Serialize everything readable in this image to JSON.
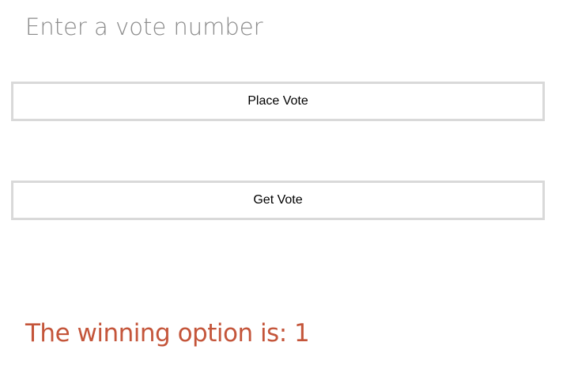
{
  "form": {
    "vote_input_placeholder": "Enter a vote number",
    "vote_input_value": "",
    "place_vote_label": "Place Vote",
    "get_vote_label": "Get Vote"
  },
  "result": {
    "text": "The winning option is: 1"
  },
  "colors": {
    "result_text": "#c4553a",
    "button_border": "#d9d9d9",
    "placeholder_text": "#8a8a8a"
  }
}
